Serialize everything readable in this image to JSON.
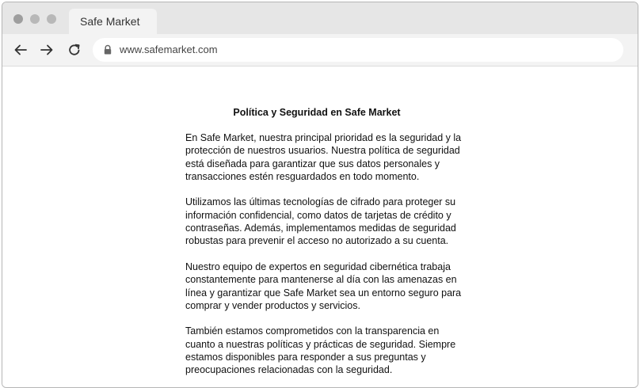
{
  "browser": {
    "tab_title": "Safe Market",
    "url": "www.safemarket.com",
    "icons": {
      "back": "arrow-left-icon",
      "forward": "arrow-right-icon",
      "reload": "reload-icon",
      "lock": "lock-icon"
    }
  },
  "page": {
    "title": "Política y Seguridad en Safe Market",
    "paragraphs": [
      "En Safe Market, nuestra principal prioridad es la seguridad y la protección de nuestros usuarios. Nuestra política de seguridad está diseñada para garantizar que sus datos personales y transacciones estén resguardados en todo momento.",
      "Utilizamos las últimas tecnologías de cifrado para proteger su información confidencial, como datos de tarjetas de crédito y contraseñas. Además, implementamos medidas de seguridad robustas para prevenir el acceso no autorizado a su cuenta.",
      "Nuestro equipo de expertos en seguridad cibernética trabaja constantemente para mantenerse al día con las amenazas en línea y garantizar que Safe Market sea un entorno seguro para comprar y vender productos y servicios.",
      "También estamos comprometidos con la transparencia en cuanto a nuestras políticas y prácticas de seguridad. Siempre estamos disponibles para responder a sus preguntas y preocupaciones relacionadas con la seguridad."
    ]
  }
}
